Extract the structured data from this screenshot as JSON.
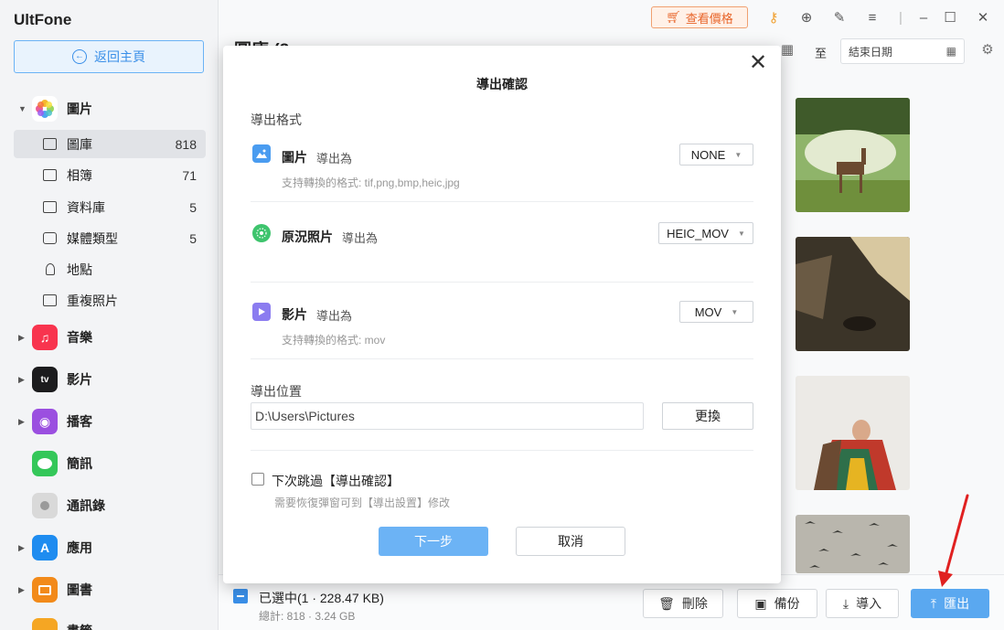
{
  "app": {
    "name": "UltFone",
    "home_button": "返回主頁"
  },
  "sidebar": {
    "photos": {
      "label": "圖片",
      "items": [
        {
          "label": "圖庫",
          "count": "818"
        },
        {
          "label": "相簿",
          "count": "71"
        },
        {
          "label": "資料庫",
          "count": "5"
        },
        {
          "label": "媒體類型",
          "count": "5"
        },
        {
          "label": "地點",
          "count": ""
        },
        {
          "label": "重複照片",
          "count": ""
        }
      ]
    },
    "categories": [
      {
        "label": "音樂",
        "icon": "music-icon",
        "color": "#f8344e"
      },
      {
        "label": "影片",
        "icon": "appletv-icon",
        "color": "#1c1c1e"
      },
      {
        "label": "播客",
        "icon": "podcast-icon",
        "color": "#9b4fe0"
      },
      {
        "label": "簡訊",
        "icon": "messages-icon",
        "color": "#34c759"
      },
      {
        "label": "通訊錄",
        "icon": "contacts-icon",
        "color": "#b9b9b9"
      },
      {
        "label": "應用",
        "icon": "appstore-icon",
        "color": "#1e8cf0"
      },
      {
        "label": "圖書",
        "icon": "books-icon",
        "color": "#f28a1a"
      },
      {
        "label": "書籤",
        "icon": "bookmarks-icon",
        "color": "#f5a623"
      }
    ]
  },
  "topbar": {
    "pricing": "查看價格"
  },
  "toolbar": {
    "title": "圖庫 (8",
    "to_label": "至",
    "end_date_placeholder": "結束日期"
  },
  "bottombar": {
    "selected": "已選中(1 · 228.47 KB)",
    "total": "總計: 818 · 3.24 GB",
    "delete": "刪除",
    "backup": "備份",
    "import": "導入",
    "export": "匯出"
  },
  "modal": {
    "title": "導出確認",
    "format_section": "導出格式",
    "export_as": "導出為",
    "rows": {
      "photo": {
        "name": "圖片",
        "value": "NONE",
        "hint": "支持轉換的格式: tif,png,bmp,heic,jpg"
      },
      "live": {
        "name": "原況照片",
        "value": "HEIC_MOV",
        "hint": ""
      },
      "video": {
        "name": "影片",
        "value": "MOV",
        "hint": "支持轉換的格式: mov"
      }
    },
    "location_section": "導出位置",
    "path": "D:\\Users\\Pictures",
    "change_button": "更換",
    "skip_label": "下次跳過【導出確認】",
    "skip_hint": "需要恢復彈窗可到【導出設置】修改",
    "next_button": "下一步",
    "cancel_button": "取消"
  },
  "colors": {
    "accent": "#3a8fe8",
    "primary_button": "#6cb3f5",
    "pricing": "#e8652a",
    "arrow": "#e02020"
  }
}
